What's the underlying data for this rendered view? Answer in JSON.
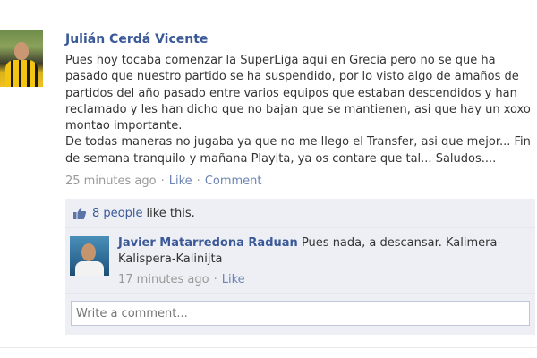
{
  "post": {
    "author": "Julián Cerdá Vicente",
    "paragraph1": "Pues hoy tocaba comenzar la SuperLiga aqui en Grecia pero no se que ha pasado que nuestro partido se ha suspendido, por lo visto algo de amaños de partidos del año pasado entre varios equipos que estaban descendidos y han reclamado y les han dicho que no bajan que se mantienen, asi que hay un xoxo montao importante.",
    "paragraph2": "De todas maneras no jugaba ya que no me llego el Transfer, asi que mejor... Fin de semana tranquilo y mañana Playita, ya os contare que tal... Saludos....",
    "time": "25 minutes ago",
    "separator": "·",
    "like_label": "Like",
    "comment_label": "Comment"
  },
  "likes": {
    "people": "8 people",
    "suffix": "like this.",
    "icon": "thumbs-up-icon"
  },
  "comments": [
    {
      "author": "Javier Matarredona Raduan",
      "text": "Pues nada, a descansar. Kalimera-Kalispera-Kalinijta",
      "time": "17 minutes ago",
      "like_label": "Like"
    }
  ],
  "composer": {
    "placeholder": "Write a comment..."
  },
  "colors": {
    "link": "#3b5998",
    "meta_link": "#6d84b4",
    "ufi_bg": "#edeff4"
  }
}
